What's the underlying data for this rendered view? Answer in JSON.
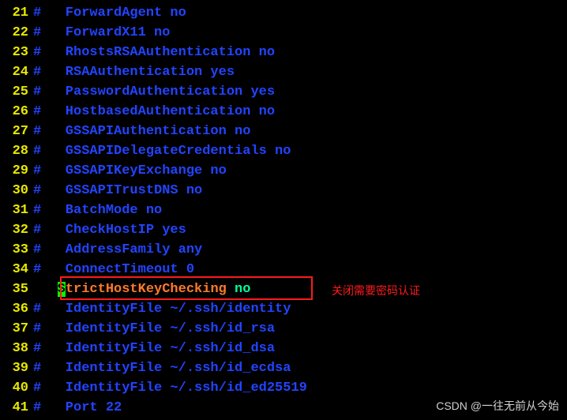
{
  "lines": [
    {
      "num": "21",
      "text": "#   ForwardAgent no"
    },
    {
      "num": "22",
      "text": "#   ForwardX11 no"
    },
    {
      "num": "23",
      "text": "#   RhostsRSAAuthentication no"
    },
    {
      "num": "24",
      "text": "#   RSAAuthentication yes"
    },
    {
      "num": "25",
      "text": "#   PasswordAuthentication yes"
    },
    {
      "num": "26",
      "text": "#   HostbasedAuthentication no"
    },
    {
      "num": "27",
      "text": "#   GSSAPIAuthentication no"
    },
    {
      "num": "28",
      "text": "#   GSSAPIDelegateCredentials no"
    },
    {
      "num": "29",
      "text": "#   GSSAPIKeyExchange no"
    },
    {
      "num": "30",
      "text": "#   GSSAPITrustDNS no"
    },
    {
      "num": "31",
      "text": "#   BatchMode no"
    },
    {
      "num": "32",
      "text": "#   CheckHostIP yes"
    },
    {
      "num": "33",
      "text": "#   AddressFamily any"
    },
    {
      "num": "34",
      "text": "#   ConnectTimeout 0"
    },
    {
      "num": "35",
      "special": true,
      "indent": "   ",
      "cursor": "S",
      "key": "trictHostKeyChecking",
      "val": " no"
    },
    {
      "num": "36",
      "text": "#   IdentityFile ~/.ssh/identity"
    },
    {
      "num": "37",
      "text": "#   IdentityFile ~/.ssh/id_rsa"
    },
    {
      "num": "38",
      "text": "#   IdentityFile ~/.ssh/id_dsa"
    },
    {
      "num": "39",
      "text": "#   IdentityFile ~/.ssh/id_ecdsa"
    },
    {
      "num": "40",
      "text": "#   IdentityFile ~/.ssh/id_ed25519"
    },
    {
      "num": "41",
      "text": "#   Port 22"
    }
  ],
  "annotation": "关闭需要密码认证",
  "watermark": "CSDN @一往无前从今始"
}
